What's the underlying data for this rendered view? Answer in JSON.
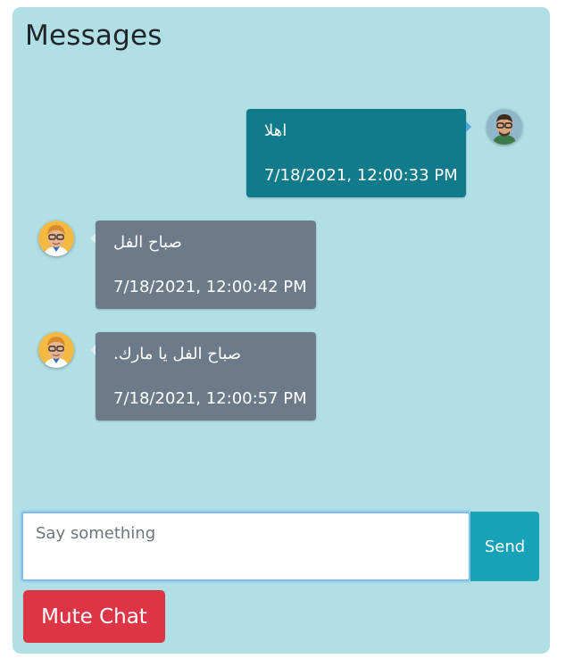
{
  "header": {
    "title": "Messages"
  },
  "messages": [
    {
      "side": "sent",
      "text": "اهلا",
      "time": "7/18/2021, 12:00:33 PM",
      "avatar": "man-with-glasses-green-shirt-avatar"
    },
    {
      "side": "received",
      "text": "صباح الفل",
      "time": "7/18/2021, 12:00:42 PM",
      "avatar": "man-with-glasses-blonde-avatar"
    },
    {
      "side": "received",
      "text": "صباح الفل يا مارك.",
      "time": "7/18/2021, 12:00:57 PM",
      "avatar": "man-with-glasses-blonde-avatar"
    }
  ],
  "composer": {
    "placeholder": "Say something",
    "value": "",
    "send_label": "Send"
  },
  "controls": {
    "mute_label": "Mute Chat"
  },
  "colors": {
    "panel_bg": "#b0dfe5",
    "sent_bubble": "#117a8b",
    "received_bubble": "#6c7a89",
    "send_button": "#17a2b8",
    "mute_button": "#dc3545"
  }
}
